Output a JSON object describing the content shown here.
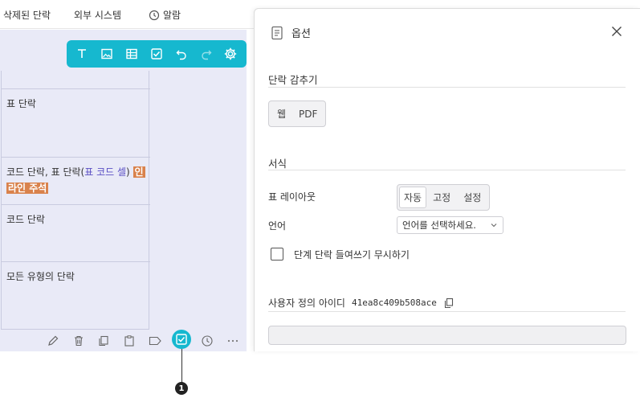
{
  "topnav": {
    "deleted_blocks": "삭제된 단락",
    "external_system": "외부 시스템",
    "alarm": "알람"
  },
  "blocks": [
    {
      "label": "표 단락"
    },
    {
      "prefix": "코드 단락, 표 단락(",
      "middle": "표 코드 셀",
      "suffix": ") ",
      "highlight1": "인",
      "highlight2": "라인 주석"
    },
    {
      "label": "코드 단락"
    },
    {
      "label": "모든 유형의 단락"
    }
  ],
  "toolbar": {
    "icons": [
      "text-icon",
      "image-icon",
      "table-icon",
      "checkbox-icon",
      "undo-icon",
      "redo-icon",
      "settings-icon"
    ]
  },
  "bottombar": {
    "icons": [
      "pencil-icon",
      "trash-icon",
      "copy-icon",
      "clipboard-icon",
      "label-icon",
      "checkbox-icon",
      "clock-icon",
      "more-icon"
    ],
    "active": "checkbox-icon"
  },
  "callout": {
    "number": "1"
  },
  "panel": {
    "title": "옵션",
    "hide_section": {
      "title": "단락 감추기",
      "options": [
        "웹",
        "PDF"
      ]
    },
    "format_section": {
      "title": "서식",
      "table_layout_label": "표 레이아웃",
      "table_layout_options": [
        "자동",
        "고정",
        "설정"
      ],
      "table_layout_selected": "자동",
      "language_label": "언어",
      "language_placeholder": "언어를 선택하세요.",
      "ignore_indent_label": "단계 단락 들여쓰기 무시하기",
      "ignore_indent_checked": false
    },
    "custom_id": {
      "label": "사용자 정의 아이디",
      "value": "41ea8c409b508ace"
    },
    "id_input_value": ""
  },
  "colors": {
    "accent": "#16b8cf",
    "doc_background": "#e9eaf7",
    "highlight": "#d9824c"
  }
}
